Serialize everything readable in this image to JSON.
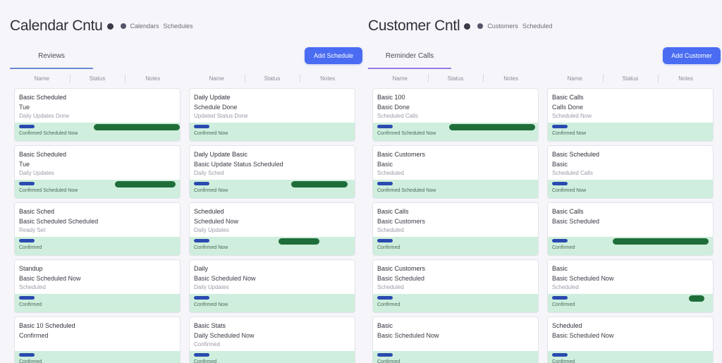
{
  "panels": [
    {
      "title": "Calendar Cntu",
      "meta": [
        "Calendars",
        "Schedules"
      ],
      "tab": "Reviews",
      "action": "Add Schedule",
      "columns": [
        {
          "headers": [
            "Name",
            "Status",
            "Notes"
          ],
          "cards": [
            {
              "l1": "Basic Scheduled",
              "l2": "Tue",
              "l3": "Daily Updates Done",
              "meta": "Confirmed Scheduled Now"
            },
            {
              "l1": "Basic Scheduled",
              "l2": "Tue",
              "l3": "Daily Updates",
              "meta": "Confirmed Scheduled Now"
            },
            {
              "l1": "Basic Sched",
              "l2": "Basic Scheduled Scheduled",
              "l3": "Ready Set",
              "meta": "Confirmed"
            },
            {
              "l1": "Standup",
              "l2": "Basic Scheduled Now",
              "l3": "Scheduled",
              "meta": "Confirmed"
            },
            {
              "l1": "Basic 10 Scheduled",
              "l2": "Confirmed",
              "l3": "",
              "meta": "Confirmed"
            }
          ]
        },
        {
          "headers": [
            "Name",
            "Status",
            "Notes"
          ],
          "cards": [
            {
              "l1": "Daily Update",
              "l2": "Schedule Done",
              "l3": "Updated Status Done",
              "meta": "Confirmed Now"
            },
            {
              "l1": "Daily Update Basic",
              "l2": "Basic Update Status Scheduled",
              "l3": "Daily Sched",
              "meta": "Confirmed Now"
            },
            {
              "l1": "Scheduled",
              "l2": "Scheduled Now",
              "l3": "Daily Updates",
              "meta": "Confirmed Now"
            },
            {
              "l1": "Daily",
              "l2": "Basic Scheduled Now",
              "l3": "Daily Updates",
              "meta": "Confirmed Now"
            },
            {
              "l1": "Basic Stats",
              "l2": "Daily Scheduled Now",
              "l3": "Confirmed",
              "meta": "Confirmed"
            }
          ]
        }
      ]
    },
    {
      "title": "Customer Cntl",
      "meta": [
        "Customers",
        "Scheduled"
      ],
      "tab": "Reminder Calls",
      "action": "Add Customer",
      "columns": [
        {
          "headers": [
            "Name",
            "Status",
            "Notes"
          ],
          "cards": [
            {
              "l1": "Basic 100",
              "l2": "Basic Done",
              "l3": "Scheduled Calls",
              "meta": "Confirmed Scheduled Now"
            },
            {
              "l1": "Basic Customers",
              "l2": "Basic",
              "l3": "Scheduled",
              "meta": "Confirmed Scheduled Now"
            },
            {
              "l1": "Basic Calls",
              "l2": "Basic Customers",
              "l3": "Scheduled",
              "meta": "Confirmed"
            },
            {
              "l1": "Basic Customers",
              "l2": "Basic Scheduled",
              "l3": "Scheduled",
              "meta": "Confirmed"
            },
            {
              "l1": "Basic",
              "l2": "Basic Scheduled Now",
              "l3": "",
              "meta": "Confirmed"
            }
          ]
        },
        {
          "headers": [
            "Name",
            "Status",
            "Notes"
          ],
          "cards": [
            {
              "l1": "Basic Calls",
              "l2": "Calls Done",
              "l3": "Scheduled Now",
              "meta": "Confirmed Now"
            },
            {
              "l1": "Basic Scheduled",
              "l2": "Basic",
              "l3": "Scheduled Calls",
              "meta": "Confirmed Now"
            },
            {
              "l1": "Basic Calls",
              "l2": "Basic Scheduled",
              "l3": "",
              "meta": "Confirmed"
            },
            {
              "l1": "Basic",
              "l2": "Basic Scheduled Now",
              "l3": "Scheduled",
              "meta": "Confirmed"
            },
            {
              "l1": "Scheduled",
              "l2": "Basic Scheduled Now",
              "l3": "",
              "meta": "Confirmed"
            }
          ]
        }
      ]
    }
  ],
  "colors": {
    "accent": "#4a6cf2",
    "strip": "#cfeedd",
    "progress": "#1f6e3a",
    "start_marker": "#2a4ab0"
  }
}
